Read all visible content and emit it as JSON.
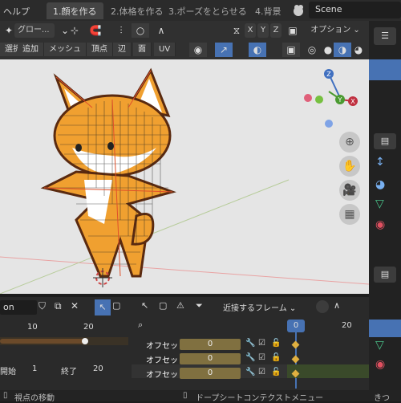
{
  "top": {
    "menu_help": "ヘルプ",
    "tabs": [
      "1.顔を作る",
      "2.体格を作る",
      "3.ポーズをとらせる",
      "4.背景"
    ],
    "scene": "Scene"
  },
  "header2": {
    "transform_orientation": "グロー...",
    "axes": [
      "X",
      "Y",
      "Z"
    ],
    "options": "オプション"
  },
  "header3": {
    "modes": [
      "選択",
      "追加",
      "メッシュ",
      "頂点",
      "辺",
      "面",
      "UV"
    ]
  },
  "gizmo": {
    "x": "X",
    "y": "Y",
    "z": "Z"
  },
  "bottom_left": {
    "name_field": "on",
    "ruler": [
      "10",
      "20"
    ],
    "start_label": "開始",
    "start_value": "1",
    "end_label": "終了",
    "end_value": "20"
  },
  "bottom_right": {
    "snap": "近接するフレーム",
    "ruler": [
      "0",
      "20"
    ],
    "current_frame": "0",
    "rows": [
      {
        "label": "オフセッ",
        "value": "0"
      },
      {
        "label": "オフセッ",
        "value": "0"
      },
      {
        "label": "オフセッ",
        "value": "0"
      }
    ]
  },
  "status": {
    "left": "視点の移動",
    "center": "ドープシートコンテクストメニュー",
    "right": "きつ"
  },
  "colors": {
    "accent": "#4772b3",
    "fox_orange": "#f0a030",
    "viewport_bg": "#e5e5e5"
  }
}
